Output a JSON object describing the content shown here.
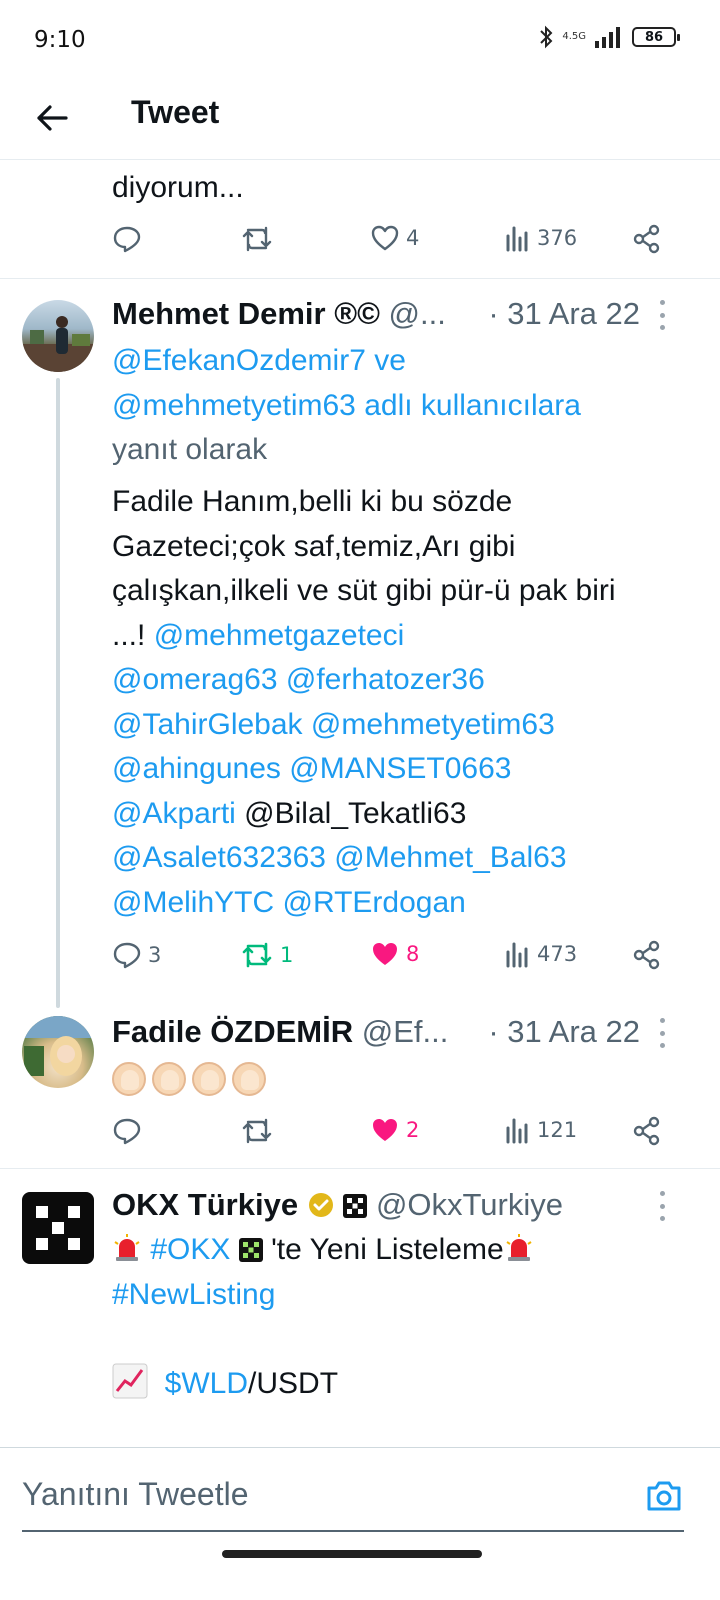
{
  "status_bar": {
    "time": "9:10",
    "network": "4.5G",
    "battery": "86"
  },
  "header": {
    "title": "Tweet"
  },
  "previous_tweet": {
    "text_tail": "diyorum...",
    "replies": "",
    "retweets": "",
    "likes": "4",
    "views": "376"
  },
  "tweet_1": {
    "name": "Mehmet Demir ®©",
    "handle": "@...",
    "date": "· 31 Ara 22",
    "reply_context_prefix": "",
    "reply_to_1": "@EfekanOzdemir7",
    "reply_connector": " ve",
    "reply_to_2": "@mehmetyetim63 adlı kullanıcılara",
    "reply_suffix": "yanıt olarak",
    "body_text": "Fadile Hanım,belli ki bu sözde Gazeteci;çok saf,temiz,Arı gibi çalışkan,ilkeli ve süt gibi pür-ü pak biri ...!",
    "mentions": {
      "m1": "@mehmetgazeteci",
      "m2": "@omerag63",
      "m3": "@ferhatozer36",
      "m4": "@TahirGlebak",
      "m5": "@mehmetyetim63",
      "m6": "@ahingunes",
      "m7": "@MANSET0663",
      "m8": "@Akparti",
      "m9_plain": "@Bilal_Tekatli63",
      "m10": "@Asalet632363",
      "m11": "@Mehmet_Bal63",
      "m12": "@MelihYTC",
      "m13": "@RTErdogan"
    },
    "replies": "3",
    "retweets": "1",
    "likes": "8",
    "views": "473"
  },
  "tweet_2": {
    "name": "Fadile ÖZDEMİR",
    "handle": "@Ef...",
    "date": "· 31 Ara 22",
    "emoji": "clapping-hands x4",
    "replies": "",
    "retweets": "",
    "likes": "2",
    "views": "121"
  },
  "tweet_3": {
    "name": "OKX Türkiye",
    "handle": "@OkxTurkiye",
    "hashtag_okx": "#OKX",
    "line1_text": "'te Yeni Listeleme",
    "hashtag_newlisting": "#NewListing",
    "cashtag": "$WLD",
    "pair_suffix": "/USDT"
  },
  "reply_composer": {
    "placeholder": "Yanıtını Tweetle"
  },
  "colors": {
    "link": "#1d9bf0",
    "muted": "#536471",
    "retweet_active": "#00ba7c",
    "like_active": "#f91880",
    "text": "#0f1419"
  },
  "icons": [
    "back-arrow-icon",
    "reply-icon",
    "retweet-icon",
    "like-icon",
    "views-icon",
    "share-icon",
    "more-icon",
    "verified-badge-icon",
    "camera-icon",
    "bluetooth-icon",
    "signal-icon",
    "battery-icon",
    "siren-emoji-icon",
    "chart-emoji-icon"
  ]
}
